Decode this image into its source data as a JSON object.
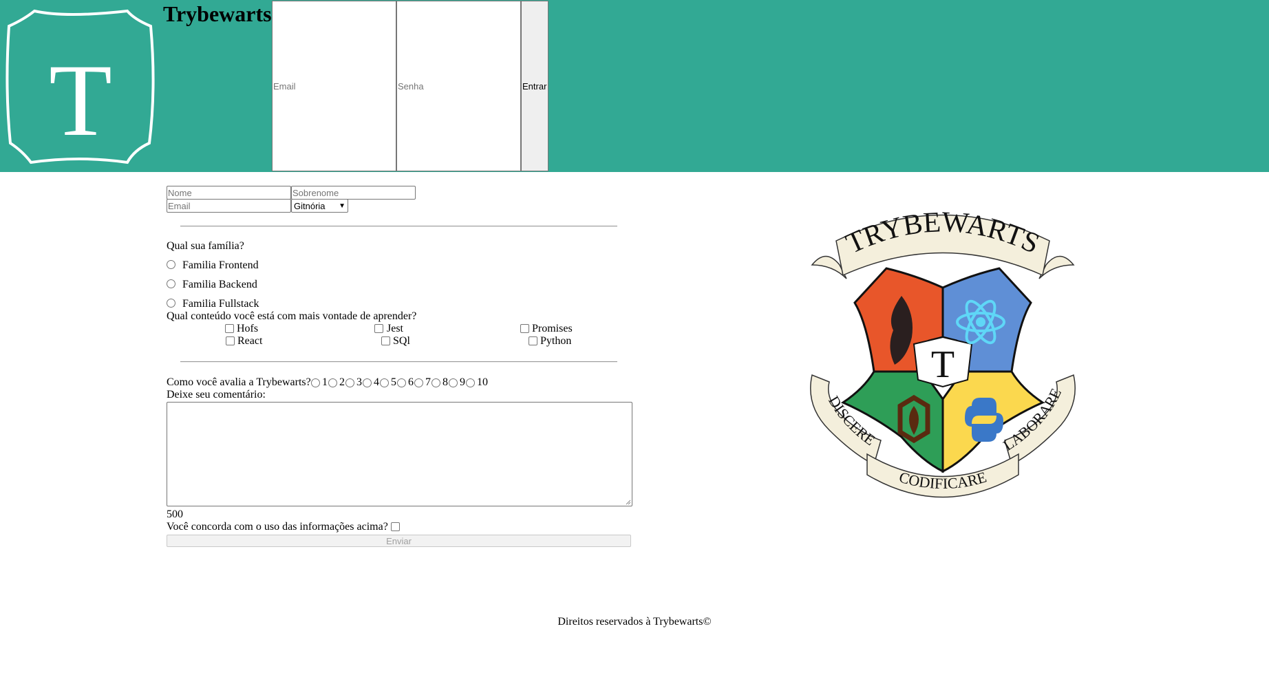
{
  "header": {
    "brand": "Trybewarts",
    "logo_letter": "T",
    "login": {
      "email_placeholder": "Email",
      "password_placeholder": "Senha",
      "submit_label": "Entrar"
    },
    "background_color": "#32a994"
  },
  "form": {
    "name_placeholder": "Nome",
    "lastname_placeholder": "Sobrenome",
    "email_placeholder": "Email",
    "house_select": {
      "selected": "Gitnória"
    },
    "family": {
      "question": "Qual sua família?",
      "options": [
        "Familia Frontend",
        "Familia Backend",
        "Familia Fullstack"
      ]
    },
    "content": {
      "question": "Qual conteúdo você está com mais vontade de aprender?",
      "options": [
        "Hofs",
        "Jest",
        "Promises",
        "React",
        "SQl",
        "Python"
      ]
    },
    "rating": {
      "question": "Como você avalia a Trybewarts?",
      "options": [
        "1",
        "2",
        "3",
        "4",
        "5",
        "6",
        "7",
        "8",
        "9",
        "10"
      ]
    },
    "comment_label": "Deixe seu comentário:",
    "counter": "500",
    "agreement_label": "Você concorda com o uso das informações acima?",
    "submit_label": "Enviar"
  },
  "crest": {
    "title": "TRYBEWARTS",
    "center_letter": "T",
    "banner_left": "DISCERE",
    "banner_bottom": "CODIFICARE",
    "banner_right": "LABORARE",
    "colors": {
      "orange": "#e8562a",
      "blue": "#5f8fd6",
      "green": "#2e9e57",
      "yellow": "#fbd84e",
      "ribbon": "#f4efdc"
    }
  },
  "footer": {
    "text": "Direitos reservados à Trybewarts©"
  }
}
